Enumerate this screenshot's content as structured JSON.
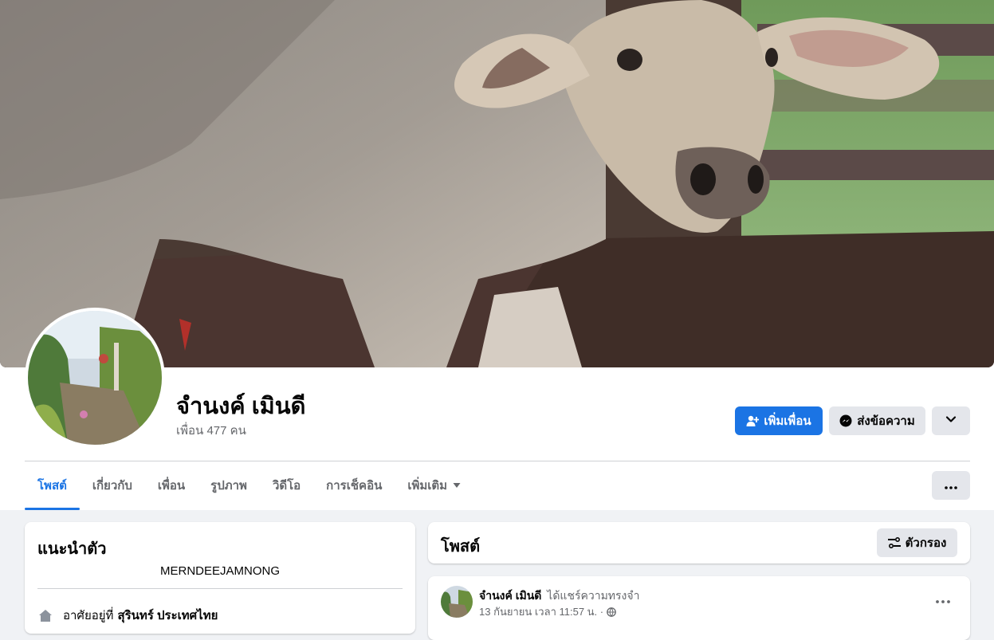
{
  "profile": {
    "name": "จำนงค์ เมินดี",
    "friends_text": "เพื่อน 477 คน"
  },
  "actions": {
    "add_friend": "เพิ่มเพื่อน",
    "message": "ส่งข้อความ"
  },
  "tabs": [
    {
      "label": "โพสต์",
      "active": true
    },
    {
      "label": "เกี่ยวกับ"
    },
    {
      "label": "เพื่อน"
    },
    {
      "label": "รูปภาพ"
    },
    {
      "label": "วิดีโอ"
    },
    {
      "label": "การเช็คอิน"
    },
    {
      "label": "เพิ่มเติม"
    }
  ],
  "intro": {
    "title": "แนะนำตัว",
    "bio": "MERNDEEJAMNONG",
    "lives_prefix": "อาศัยอยู่ที่",
    "lives_place": "สุรินทร์ ประเทศไทย"
  },
  "posts_card": {
    "title": "โพสต์",
    "filter_label": "ตัวกรอง"
  },
  "post": {
    "author": "จำนงค์ เมินดี",
    "action": "ได้แชร์ความทรงจำ",
    "date": "13 กันยายน เวลา 11:57 น. ·"
  },
  "colors": {
    "accent": "#1b74e4",
    "background": "#f0f2f5",
    "secondary_button": "#e4e6eb"
  }
}
